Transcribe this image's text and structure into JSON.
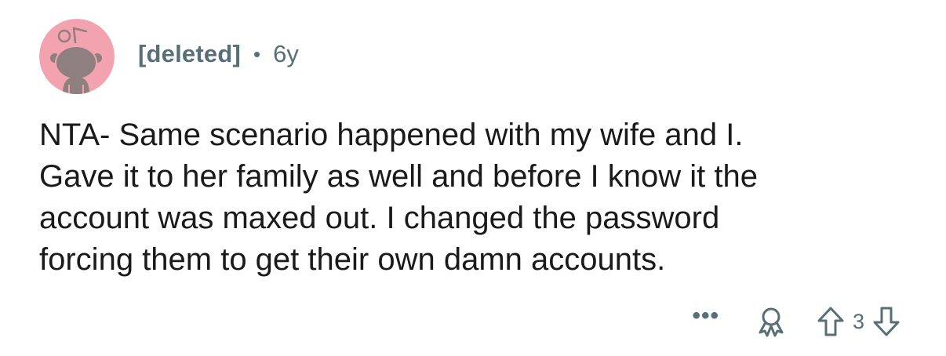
{
  "comment": {
    "author": "[deleted]",
    "separator": "•",
    "age": "6y",
    "body_lines": [
      "NTA- Same scenario happened with my wife and I.",
      "Gave it to her family as well and before I know it the",
      "account was maxed out. I changed the password",
      "forcing them to get their own damn accounts."
    ],
    "actions": {
      "more_label": "•••",
      "award_icon": "award-icon",
      "upvote_icon": "upvote-arrow-icon",
      "score": "3",
      "downvote_icon": "downvote-arrow-icon"
    }
  },
  "colors": {
    "avatar_bg": "#f3a2b0",
    "avatar_snoo": "#8f8080",
    "meta_text": "#576f76",
    "body_text": "#1a1a1b"
  }
}
